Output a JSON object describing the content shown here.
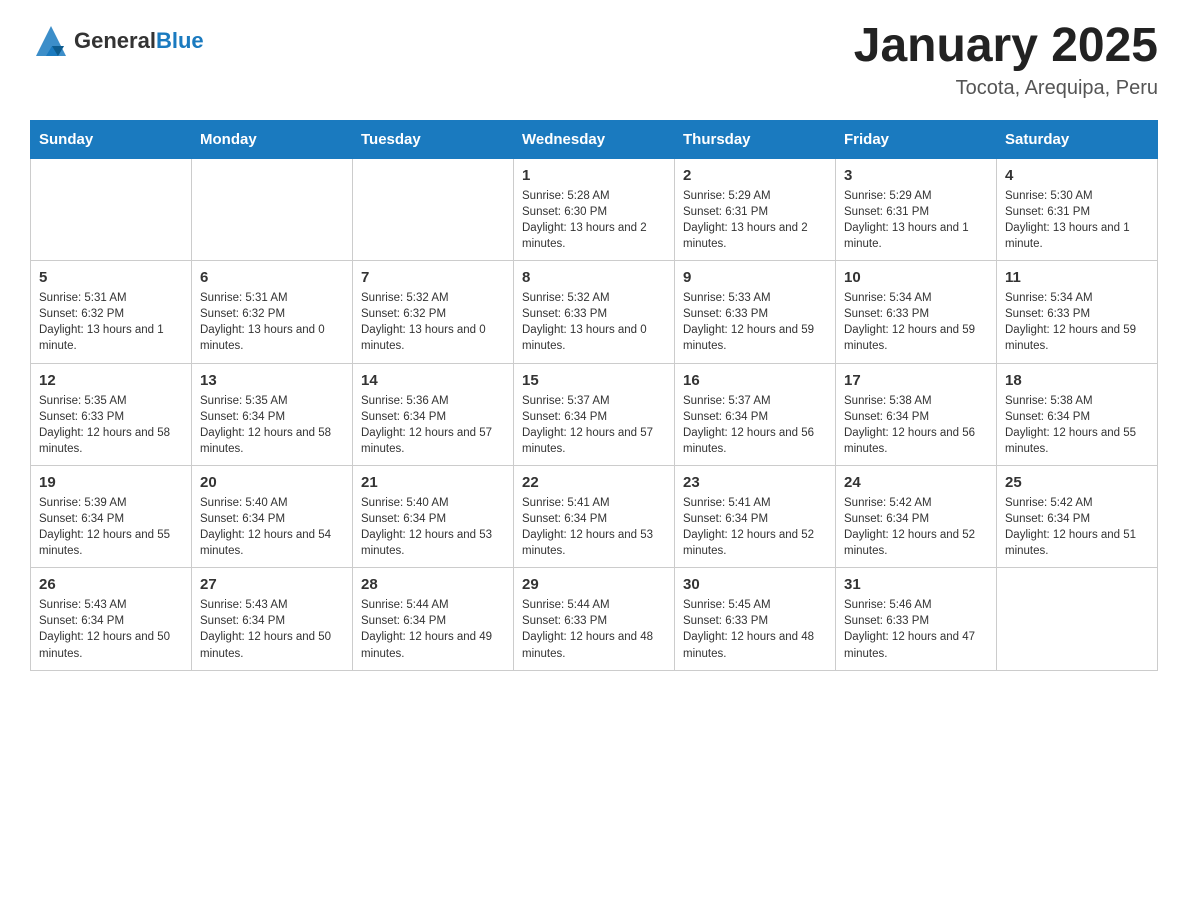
{
  "logo": {
    "text_general": "General",
    "text_blue": "Blue"
  },
  "header": {
    "month_year": "January 2025",
    "location": "Tocota, Arequipa, Peru"
  },
  "days_of_week": [
    "Sunday",
    "Monday",
    "Tuesday",
    "Wednesday",
    "Thursday",
    "Friday",
    "Saturday"
  ],
  "weeks": [
    [
      {
        "day": "",
        "info": ""
      },
      {
        "day": "",
        "info": ""
      },
      {
        "day": "",
        "info": ""
      },
      {
        "day": "1",
        "info": "Sunrise: 5:28 AM\nSunset: 6:30 PM\nDaylight: 13 hours and 2 minutes."
      },
      {
        "day": "2",
        "info": "Sunrise: 5:29 AM\nSunset: 6:31 PM\nDaylight: 13 hours and 2 minutes."
      },
      {
        "day": "3",
        "info": "Sunrise: 5:29 AM\nSunset: 6:31 PM\nDaylight: 13 hours and 1 minute."
      },
      {
        "day": "4",
        "info": "Sunrise: 5:30 AM\nSunset: 6:31 PM\nDaylight: 13 hours and 1 minute."
      }
    ],
    [
      {
        "day": "5",
        "info": "Sunrise: 5:31 AM\nSunset: 6:32 PM\nDaylight: 13 hours and 1 minute."
      },
      {
        "day": "6",
        "info": "Sunrise: 5:31 AM\nSunset: 6:32 PM\nDaylight: 13 hours and 0 minutes."
      },
      {
        "day": "7",
        "info": "Sunrise: 5:32 AM\nSunset: 6:32 PM\nDaylight: 13 hours and 0 minutes."
      },
      {
        "day": "8",
        "info": "Sunrise: 5:32 AM\nSunset: 6:33 PM\nDaylight: 13 hours and 0 minutes."
      },
      {
        "day": "9",
        "info": "Sunrise: 5:33 AM\nSunset: 6:33 PM\nDaylight: 12 hours and 59 minutes."
      },
      {
        "day": "10",
        "info": "Sunrise: 5:34 AM\nSunset: 6:33 PM\nDaylight: 12 hours and 59 minutes."
      },
      {
        "day": "11",
        "info": "Sunrise: 5:34 AM\nSunset: 6:33 PM\nDaylight: 12 hours and 59 minutes."
      }
    ],
    [
      {
        "day": "12",
        "info": "Sunrise: 5:35 AM\nSunset: 6:33 PM\nDaylight: 12 hours and 58 minutes."
      },
      {
        "day": "13",
        "info": "Sunrise: 5:35 AM\nSunset: 6:34 PM\nDaylight: 12 hours and 58 minutes."
      },
      {
        "day": "14",
        "info": "Sunrise: 5:36 AM\nSunset: 6:34 PM\nDaylight: 12 hours and 57 minutes."
      },
      {
        "day": "15",
        "info": "Sunrise: 5:37 AM\nSunset: 6:34 PM\nDaylight: 12 hours and 57 minutes."
      },
      {
        "day": "16",
        "info": "Sunrise: 5:37 AM\nSunset: 6:34 PM\nDaylight: 12 hours and 56 minutes."
      },
      {
        "day": "17",
        "info": "Sunrise: 5:38 AM\nSunset: 6:34 PM\nDaylight: 12 hours and 56 minutes."
      },
      {
        "day": "18",
        "info": "Sunrise: 5:38 AM\nSunset: 6:34 PM\nDaylight: 12 hours and 55 minutes."
      }
    ],
    [
      {
        "day": "19",
        "info": "Sunrise: 5:39 AM\nSunset: 6:34 PM\nDaylight: 12 hours and 55 minutes."
      },
      {
        "day": "20",
        "info": "Sunrise: 5:40 AM\nSunset: 6:34 PM\nDaylight: 12 hours and 54 minutes."
      },
      {
        "day": "21",
        "info": "Sunrise: 5:40 AM\nSunset: 6:34 PM\nDaylight: 12 hours and 53 minutes."
      },
      {
        "day": "22",
        "info": "Sunrise: 5:41 AM\nSunset: 6:34 PM\nDaylight: 12 hours and 53 minutes."
      },
      {
        "day": "23",
        "info": "Sunrise: 5:41 AM\nSunset: 6:34 PM\nDaylight: 12 hours and 52 minutes."
      },
      {
        "day": "24",
        "info": "Sunrise: 5:42 AM\nSunset: 6:34 PM\nDaylight: 12 hours and 52 minutes."
      },
      {
        "day": "25",
        "info": "Sunrise: 5:42 AM\nSunset: 6:34 PM\nDaylight: 12 hours and 51 minutes."
      }
    ],
    [
      {
        "day": "26",
        "info": "Sunrise: 5:43 AM\nSunset: 6:34 PM\nDaylight: 12 hours and 50 minutes."
      },
      {
        "day": "27",
        "info": "Sunrise: 5:43 AM\nSunset: 6:34 PM\nDaylight: 12 hours and 50 minutes."
      },
      {
        "day": "28",
        "info": "Sunrise: 5:44 AM\nSunset: 6:34 PM\nDaylight: 12 hours and 49 minutes."
      },
      {
        "day": "29",
        "info": "Sunrise: 5:44 AM\nSunset: 6:33 PM\nDaylight: 12 hours and 48 minutes."
      },
      {
        "day": "30",
        "info": "Sunrise: 5:45 AM\nSunset: 6:33 PM\nDaylight: 12 hours and 48 minutes."
      },
      {
        "day": "31",
        "info": "Sunrise: 5:46 AM\nSunset: 6:33 PM\nDaylight: 12 hours and 47 minutes."
      },
      {
        "day": "",
        "info": ""
      }
    ]
  ]
}
